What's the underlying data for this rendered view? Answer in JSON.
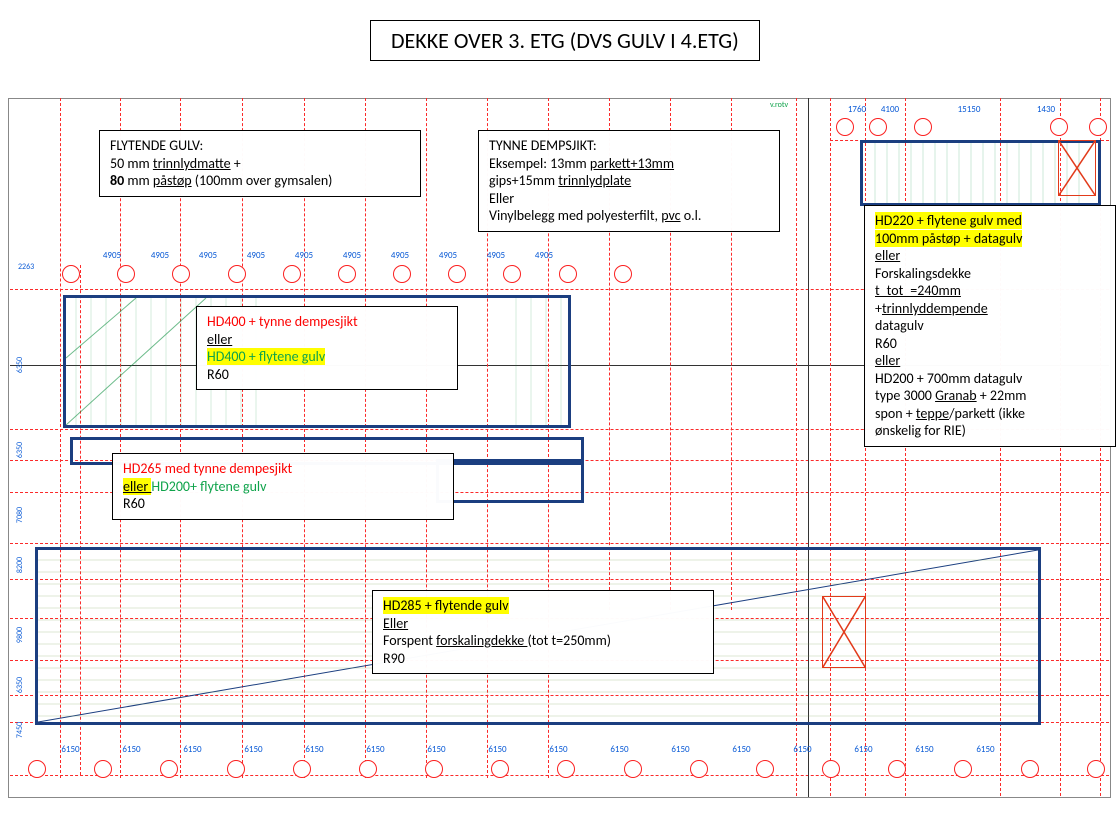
{
  "title": "DEKKE OVER 3. ETG (DVS GULV I 4.ETG)",
  "boxes": {
    "flytende": {
      "heading": "FLYTENDE GULV:",
      "l1a": "50 mm ",
      "l1b": "trinnlydmatte",
      "l1c": " +",
      "l2a": "80",
      "l2b": " mm ",
      "l2c": "påstøp",
      "l2d": " (100mm over gymsalen)"
    },
    "tynne": {
      "heading": "TYNNE DEMPSJIKT:",
      "l1a": "Eksempel: 13mm ",
      "l1b": "parkett+13mm",
      "l2a": "gips+15mm ",
      "l2b": "trinnlydplate",
      "l3": "Eller",
      "l4a": "Vinylbelegg med polyesterfilt, ",
      "l4b": "pvc",
      "l4c": " o.l."
    },
    "hd400": {
      "l1": "HD400 + tynne dempesjikt",
      "l2": "eller",
      "l3": "HD400 + flytene gulv",
      "l4": "R60"
    },
    "hd265": {
      "l1": "HD265 med tynne dempesjikt",
      "l2": "eller ",
      "l3": "HD200+ flytene gulv",
      "l4": "R60"
    },
    "hd285": {
      "l1": "HD285 + flytende gulv",
      "l2": "Eller",
      "l3a": "Forspent ",
      "l3b": "forskalingdekke ",
      "l3c": "(tot t=250mm)",
      "l4": "R90"
    },
    "hd220": {
      "l1a": "HD220 + flytene gulv med",
      "l1b": "100mm påstøp + datagulv",
      "l2": "eller",
      "l3": "Forskalingsdekke",
      "l4": "t_tot_=240mm",
      "l5a": "+",
      "l5b": "trinnlyddempende",
      "l6": "datagulv",
      "l7": "R60",
      "l8": "eller",
      "l9": "HD200 + 700mm datagulv",
      "l10a": "type 3000 ",
      "l10b": "Granab",
      "l10c": " + 22mm",
      "l11a": "spon + ",
      "l11b": "teppe",
      "l11c": "/parkett (ikke",
      "l12": "ønskelig for RIE)"
    }
  },
  "dims": {
    "top_axis": [
      "2263",
      "4905",
      "4905",
      "4905",
      "4905",
      "4905",
      "4905",
      "4905",
      "4905",
      "4905",
      "4905"
    ],
    "top_right": [
      "1760",
      "4100",
      "15150",
      "1430"
    ],
    "bottom": [
      "6150",
      "6150",
      "6150",
      "6150",
      "6150",
      "6150",
      "6150",
      "6150",
      "6150",
      "6150",
      "6150",
      "6150",
      "6150",
      "6150",
      "6150",
      "6150"
    ],
    "left_v": [
      "6350",
      "7080",
      "8200",
      "9800",
      "6350",
      "7450"
    ]
  },
  "green_tag": "v.rotv"
}
